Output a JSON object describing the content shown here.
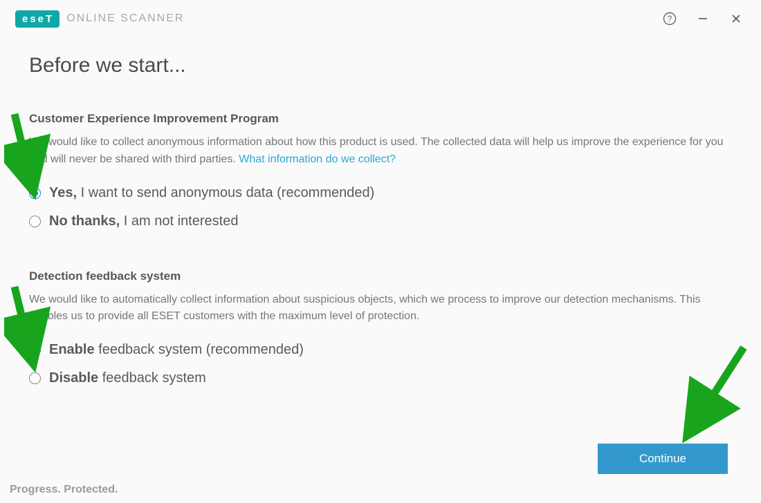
{
  "brand": {
    "logo_text": "eseT",
    "product_name": "ONLINE SCANNER"
  },
  "page": {
    "title": "Before we start..."
  },
  "section1": {
    "heading": "Customer Experience Improvement Program",
    "desc_pre": "We would like to collect anonymous information about how this product is used. The collected data will help us improve the experience for you and will never be shared with third parties. ",
    "link_text": "What information do we collect?",
    "opt1_bold": "Yes,",
    "opt1_rest": " I want to send anonymous data (recommended)",
    "opt2_bold": "No thanks,",
    "opt2_rest": " I am not interested",
    "selected": "yes"
  },
  "section2": {
    "heading": "Detection feedback system",
    "desc": "We would like to automatically collect information about suspicious objects, which we process to improve our detection mechanisms. This enables us to provide all ESET customers with the maximum level of protection.",
    "opt1_bold": "Enable",
    "opt1_rest": " feedback system (recommended)",
    "opt2_bold": "Disable",
    "opt2_rest": " feedback system",
    "selected": "enable"
  },
  "footer": {
    "continue_label": "Continue",
    "tagline": "Progress. Protected."
  }
}
